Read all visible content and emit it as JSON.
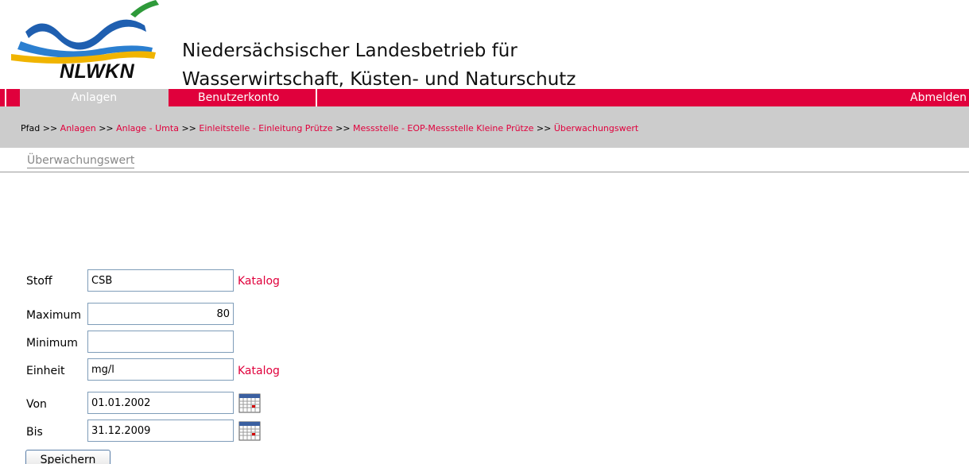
{
  "header": {
    "logo_text": "NLWKN",
    "org_line1": "Niedersächsischer Landesbetrieb für",
    "org_line2": "Wasserwirtschaft, Küsten- und Naturschutz"
  },
  "nav": {
    "active_tab": "Anlagen",
    "tab_account": "Benutzerkonto",
    "logout": "Abmelden"
  },
  "breadcrumb": {
    "label": "Pfad >>",
    "sep": ">>",
    "items": [
      "Anlagen",
      "Anlage - Umta",
      "Einleitstelle - Einleitung Prütze",
      "Messstelle - EOP-Messstelle Kleine Prütze",
      "Überwachungswert"
    ]
  },
  "subtab": "Überwachungswert",
  "form": {
    "stoff": {
      "label": "Stoff",
      "value": "CSB",
      "link": "Katalog"
    },
    "maximum": {
      "label": "Maximum",
      "value": "80"
    },
    "minimum": {
      "label": "Minimum",
      "value": ""
    },
    "einheit": {
      "label": "Einheit",
      "value": "mg/l",
      "link": "Katalog"
    },
    "von": {
      "label": "Von",
      "value": "01.01.2002",
      "icon": "calendar-icon"
    },
    "bis": {
      "label": "Bis",
      "value": "31.12.2009",
      "icon": "calendar-icon"
    },
    "save_label": "Speichern"
  },
  "colors": {
    "accent": "#e0003c",
    "bar_gray": "#cccccc"
  }
}
